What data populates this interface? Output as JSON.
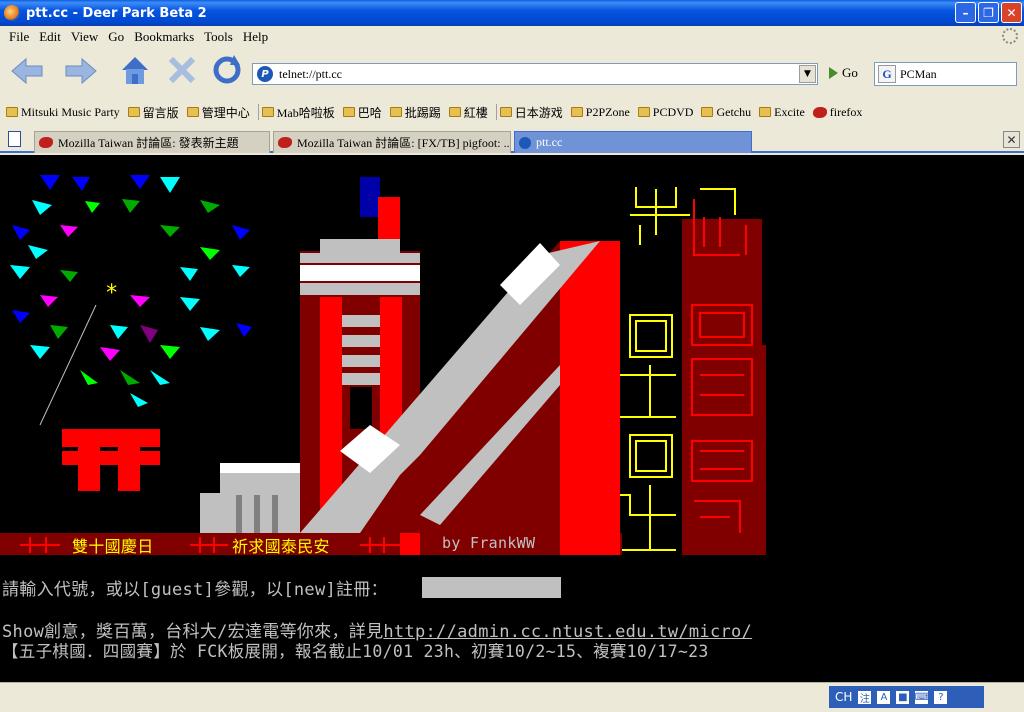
{
  "window": {
    "title": "ptt.cc - Deer Park Beta 2"
  },
  "menu": [
    "File",
    "Edit",
    "View",
    "Go",
    "Bookmarks",
    "Tools",
    "Help"
  ],
  "address": {
    "value": "telnet://ptt.cc",
    "go_label": "Go"
  },
  "search": {
    "value": "PCMan"
  },
  "bookmarks": [
    {
      "label": "Mitsuki Music Party",
      "icon": "folder-icon"
    },
    {
      "label": "留言版",
      "icon": "folder-icon"
    },
    {
      "label": "管理中心",
      "icon": "folder-icon"
    },
    {
      "label": "Mab哈啦板",
      "icon": "folder-icon"
    },
    {
      "label": "巴哈",
      "icon": "folder-icon"
    },
    {
      "label": "批踢踢",
      "icon": "folder-icon"
    },
    {
      "label": "紅樓",
      "icon": "folder-icon"
    },
    {
      "label": "日本游戏",
      "icon": "folder-icon"
    },
    {
      "label": "P2PZone",
      "icon": "folder-icon"
    },
    {
      "label": "PCDVD",
      "icon": "folder-icon"
    },
    {
      "label": "Getchu",
      "icon": "folder-icon"
    },
    {
      "label": "Excite",
      "icon": "folder-icon"
    },
    {
      "label": "firefox",
      "icon": "firefox-icon"
    }
  ],
  "tabs": [
    {
      "label": "Mozilla Taiwan 討論區: 發表新主題",
      "active": false
    },
    {
      "label": "Mozilla Taiwan 討論區: [FX/TB] pigfoot: ...",
      "active": false
    },
    {
      "label": "ptt.cc",
      "active": true
    }
  ],
  "terminal": {
    "banner_left": "雙十國慶日",
    "banner_mid": "祈求國泰民安",
    "banner_right": "by FrankWW",
    "prompt": "請輸入代號，或以[guest]參觀，以[new]註冊：",
    "line_show": "Show創意，獎百萬，台科大/宏達電等你來，詳見",
    "link": "http://admin.cc.ntust.edu.tw/micro/",
    "line_game": "【五子棋國．四國賽】於 FCK板展開，報名截止10/01 23h、初賽10/2~15、複賽10/17~23"
  },
  "ime": {
    "mode": "CH"
  }
}
